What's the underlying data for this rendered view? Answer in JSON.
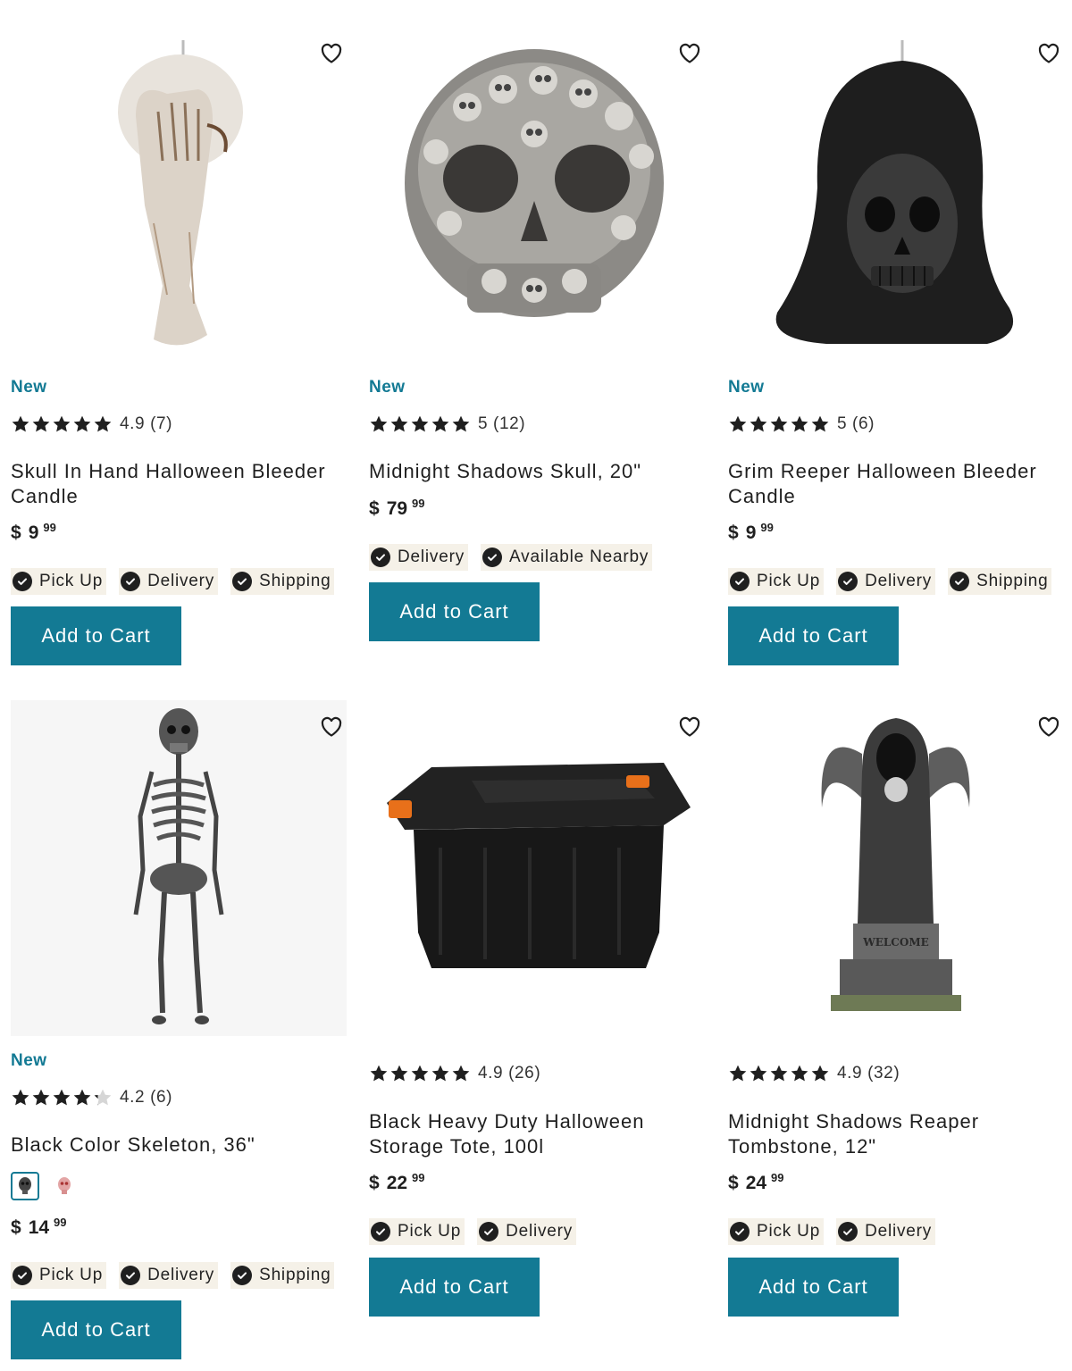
{
  "colors": {
    "accent": "#137a94",
    "chip_bg": "#f5f1e8",
    "star": "#1f1f1f"
  },
  "products": [
    {
      "badge": "New",
      "rating_stars": 5,
      "rating_text": "4.9 (7)",
      "title": "Skull In Hand Halloween Bleeder Candle",
      "price_currency": "$",
      "price_dollars": "9",
      "price_cents": "99",
      "fulfillment": [
        "Pick Up",
        "Delivery",
        "Shipping"
      ],
      "cta": "Add to Cart",
      "image_icon": "skull-hand-candle-icon"
    },
    {
      "badge": "New",
      "rating_stars": 5,
      "rating_text": "5 (12)",
      "title": "Midnight Shadows Skull, 20\"",
      "price_currency": "$",
      "price_dollars": "79",
      "price_cents": "99",
      "fulfillment": [
        "Delivery",
        "Available Nearby"
      ],
      "cta": "Add to Cart",
      "image_icon": "skull-of-skulls-icon"
    },
    {
      "badge": "New",
      "rating_stars": 5,
      "rating_text": "5 (6)",
      "title": "Grim Reeper Halloween Bleeder Candle",
      "price_currency": "$",
      "price_dollars": "9",
      "price_cents": "99",
      "fulfillment": [
        "Pick Up",
        "Delivery",
        "Shipping"
      ],
      "cta": "Add to Cart",
      "image_icon": "grim-reaper-candle-icon"
    },
    {
      "badge": "New",
      "rating_stars": 4.2,
      "rating_text": "4.2 (6)",
      "title": "Black Color Skeleton, 36\"",
      "swatches": [
        "black-skeleton-swatch-icon",
        "pink-skull-swatch-icon"
      ],
      "price_currency": "$",
      "price_dollars": "14",
      "price_cents": "99",
      "fulfillment": [
        "Pick Up",
        "Delivery",
        "Shipping"
      ],
      "cta": "Add to Cart",
      "image_icon": "skeleton-icon"
    },
    {
      "badge": "",
      "rating_stars": 5,
      "rating_text": "4.9 (26)",
      "title": "Black Heavy Duty Halloween Storage Tote, 100l",
      "price_currency": "$",
      "price_dollars": "22",
      "price_cents": "99",
      "fulfillment": [
        "Pick Up",
        "Delivery"
      ],
      "cta": "Add to Cart",
      "image_icon": "storage-tote-icon"
    },
    {
      "badge": "",
      "rating_stars": 5,
      "rating_text": "4.9 (32)",
      "title": "Midnight Shadows Reaper Tombstone, 12\"",
      "price_currency": "$",
      "price_dollars": "24",
      "price_cents": "99",
      "fulfillment": [
        "Pick Up",
        "Delivery"
      ],
      "cta": "Add to Cart",
      "image_icon": "reaper-tombstone-icon",
      "image_text": "WELCOME"
    }
  ]
}
